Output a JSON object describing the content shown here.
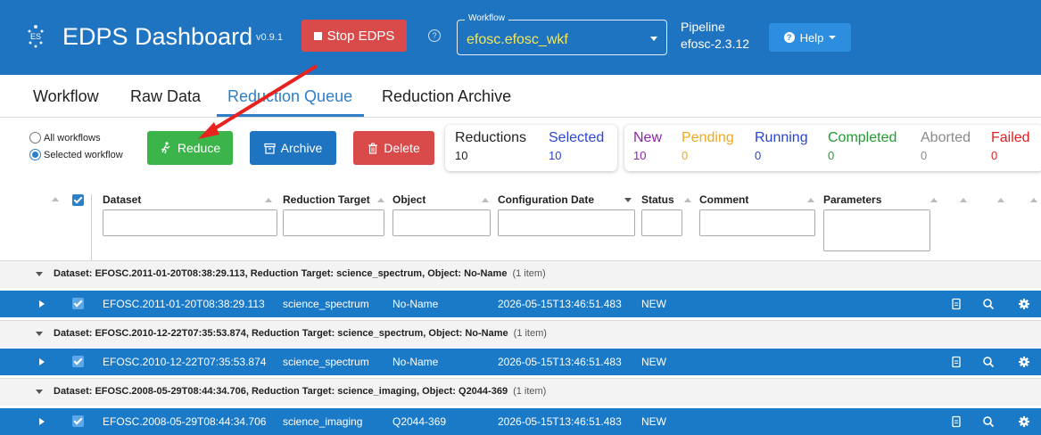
{
  "header": {
    "title": "EDPS Dashboard",
    "version": "v0.9.1",
    "stop_label": "Stop EDPS",
    "workflow_legend": "Workflow",
    "workflow_value": "efosc.efosc_wkf",
    "pipeline_label": "Pipeline",
    "pipeline_value": "efosc-2.3.12",
    "help_label": "Help"
  },
  "tabs": [
    {
      "label": "Workflow"
    },
    {
      "label": "Raw Data"
    },
    {
      "label": "Reduction Queue"
    },
    {
      "label": "Reduction Archive"
    }
  ],
  "scope": {
    "all_label": "All workflows",
    "selected_label": "Selected workflow",
    "selected": "Selected workflow"
  },
  "actions": {
    "reduce": "Reduce",
    "archive": "Archive",
    "delete": "Delete"
  },
  "stats_main": [
    {
      "label": "Reductions",
      "value": "10",
      "color": "#222222"
    },
    {
      "label": "Selected",
      "value": "10",
      "color": "#2a44d4"
    }
  ],
  "stats_status": [
    {
      "label": "New",
      "value": "10",
      "color": "#8e24aa"
    },
    {
      "label": "Pending",
      "value": "0",
      "color": "#f0a81c"
    },
    {
      "label": "Running",
      "value": "0",
      "color": "#2a44d4"
    },
    {
      "label": "Completed",
      "value": "0",
      "color": "#1e9c2e"
    },
    {
      "label": "Aborted",
      "value": "0",
      "color": "#8a8a8a"
    },
    {
      "label": "Failed",
      "value": "0",
      "color": "#e02020"
    }
  ],
  "columns": [
    "Dataset",
    "Reduction Target",
    "Object",
    "Configuration Date",
    "Status",
    "Comment",
    "Parameters"
  ],
  "groups": [
    {
      "label": "Dataset: EFOSC.2011-01-20T08:38:29.113, Reduction Target: science_spectrum, Object: No-Name",
      "count": "(1 item)",
      "row": {
        "dataset": "EFOSC.2011-01-20T08:38:29.113",
        "target": "science_spectrum",
        "object": "No-Name",
        "date": "2026-05-15T13:46:51.483",
        "status": "NEW"
      }
    },
    {
      "label": "Dataset: EFOSC.2010-12-22T07:35:53.874, Reduction Target: science_spectrum, Object: No-Name",
      "count": "(1 item)",
      "row": {
        "dataset": "EFOSC.2010-12-22T07:35:53.874",
        "target": "science_spectrum",
        "object": "No-Name",
        "date": "2026-05-15T13:46:51.483",
        "status": "NEW"
      }
    },
    {
      "label": "Dataset: EFOSC.2008-05-29T08:44:34.706, Reduction Target: science_imaging, Object: Q2044-369",
      "count": "(1 item)",
      "row": {
        "dataset": "EFOSC.2008-05-29T08:44:34.706",
        "target": "science_imaging",
        "object": "Q2044-369",
        "date": "2026-05-15T13:46:51.483",
        "status": "NEW"
      }
    }
  ],
  "row_icons": [
    "document-icon",
    "search-icon",
    "gear-icon"
  ]
}
